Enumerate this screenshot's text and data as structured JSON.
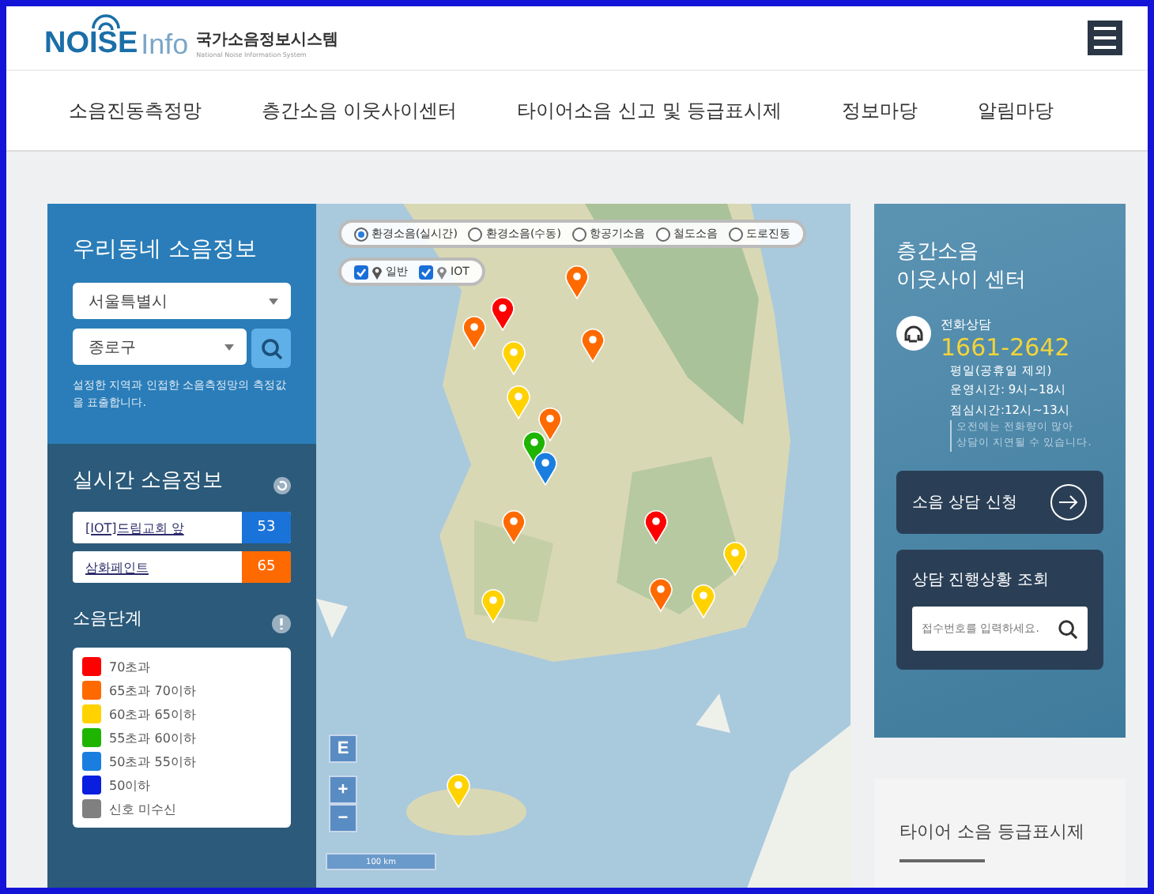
{
  "header": {
    "logo": {
      "brand": "NOISE",
      "sub": "Info",
      "title": "국가소음정보시스템",
      "subtitle": "National Noise Information System"
    }
  },
  "nav": [
    {
      "label": "소음진동측정망"
    },
    {
      "label": "층간소음 이웃사이센터"
    },
    {
      "label": "타이어소음 신고 및 등급표시제"
    },
    {
      "label": "정보마당"
    },
    {
      "label": "알림마당"
    }
  ],
  "neighborhood": {
    "title": "우리동네 소음정보",
    "selects": [
      "서울특별시",
      "종로구"
    ],
    "note": "설정한 지역과 인접한 소음측정망의 측정값을 표출합니다."
  },
  "realtime": {
    "title": "실시간 소음정보",
    "items": [
      {
        "name": "[IOT]드림교회 앞",
        "value": "53",
        "color": "#1a73d9"
      },
      {
        "name": "삼화페인트",
        "value": "65",
        "color": "#ff6a00"
      }
    ]
  },
  "levels": {
    "title": "소음단계",
    "items": [
      {
        "label": "70초과",
        "color": "#ff0000"
      },
      {
        "label": "65초과 70이하",
        "color": "#ff6a00"
      },
      {
        "label": "60초과 65이하",
        "color": "#ffd200"
      },
      {
        "label": "55초과 60이하",
        "color": "#1eb400"
      },
      {
        "label": "50초과 55이하",
        "color": "#1a7ee0"
      },
      {
        "label": "50이하",
        "color": "#0a1ee0"
      },
      {
        "label": "신호 미수신",
        "color": "#808080"
      }
    ]
  },
  "map": {
    "layers": [
      {
        "label": "환경소음(실시간)",
        "selected": true
      },
      {
        "label": "환경소음(수동)",
        "selected": false
      },
      {
        "label": "항공기소음",
        "selected": false
      },
      {
        "label": "철도소음",
        "selected": false
      },
      {
        "label": "도로진동",
        "selected": false
      }
    ],
    "filters": [
      {
        "label": "일반",
        "checked": true,
        "kind": "general"
      },
      {
        "label": "IOT",
        "checked": true,
        "kind": "iot"
      }
    ],
    "compass": "E",
    "zoom_in": "+",
    "zoom_out": "−",
    "scale": "100 km"
  },
  "center": {
    "title": [
      "층간소음",
      "이웃사이 센터"
    ],
    "phone_label": "전화상담",
    "phone": "1661-2642",
    "hours": [
      "평일(공휴일 제외)",
      "운영시간: 9시~18시",
      "점심시간:12시~13시"
    ],
    "note": [
      "오전에는 전화량이 많아",
      "상담이 지연될 수 있습니다."
    ],
    "apply_button": "소음 상담 신청",
    "lookup_title": "상담 진행상황 조회",
    "lookup_placeholder": "접수번호를 입력하세요."
  },
  "tire": {
    "title": "타이어 소음 등급표시제"
  }
}
